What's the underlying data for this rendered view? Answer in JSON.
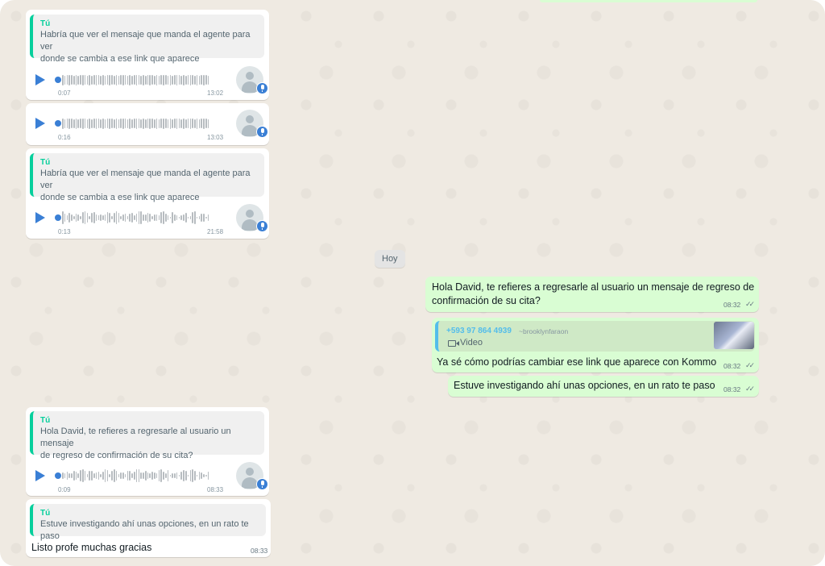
{
  "colors": {
    "chat_background": "#efeae2",
    "incoming_bubble": "#ffffff",
    "outgoing_bubble": "#d9fdd3",
    "quote_accent": "#06cf9c",
    "play_accent": "#3a7fd5"
  },
  "day_separator": "Hoy",
  "incoming": [
    {
      "quote_author": "Tú",
      "quote_line1": "Habría que ver el mensaje que manda el agente para ver",
      "quote_line2": "donde se cambia a ese link que aparece",
      "duration": "0:07",
      "time": "13:02"
    },
    {
      "duration": "0:16",
      "time": "13:03"
    },
    {
      "quote_author": "Tú",
      "quote_line1": "Habría que ver el mensaje que manda el agente para ver",
      "quote_line2": "donde se cambia a ese link que aparece",
      "duration": "0:13",
      "time": "21:58"
    },
    {
      "quote_author": "Tú",
      "quote_line1": "Hola David, te refieres a regresarle al usuario un mensaje",
      "quote_line2": "de regreso de confirmación de su cita?",
      "duration": "0:09",
      "time": "08:33"
    },
    {
      "quote_author": "Tú",
      "quote_line1": "Estuve investigando ahí unas opciones, en un rato te paso",
      "text": "Listo profe muchas gracias",
      "time": "08:33"
    }
  ],
  "outgoing": [
    {
      "line1": "Hola David, te refieres a regresarle al usuario un mensaje de regreso de",
      "line2": "confirmación de su cita?",
      "time": "08:32",
      "ticks": "✓✓"
    },
    {
      "quote_phone": "+593 97 864 4939",
      "quote_handle": "~brooklynfaraon",
      "quote_media_label": "Video",
      "text": "Ya sé cómo podrías cambiar ese link que aparece con Kommo",
      "time": "08:32",
      "ticks": "✓✓"
    },
    {
      "text": "Estuve investigando ahí unas opciones, en un rato te paso",
      "time": "08:32",
      "ticks": "✓✓"
    }
  ]
}
